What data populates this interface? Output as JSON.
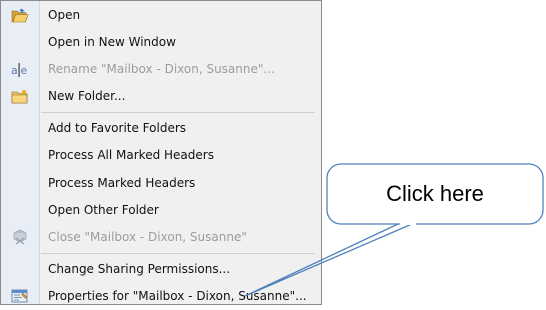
{
  "menu": {
    "items": [
      {
        "label": "Open",
        "enabled": true,
        "icon": "open-folder-icon"
      },
      {
        "label": "Open in New Window",
        "enabled": true,
        "icon": ""
      },
      {
        "label": "Rename \"Mailbox - Dixon, Susanne\"...",
        "enabled": false,
        "icon": "rename-icon"
      },
      {
        "label": "New Folder...",
        "enabled": true,
        "icon": "new-folder-icon"
      },
      {
        "label": "Add to Favorite Folders",
        "enabled": true,
        "icon": ""
      },
      {
        "label": "Process All Marked Headers",
        "enabled": true,
        "icon": ""
      },
      {
        "label": "Process Marked Headers",
        "enabled": true,
        "icon": ""
      },
      {
        "label": "Open Other Folder",
        "enabled": true,
        "icon": ""
      },
      {
        "label": "Close \"Mailbox - Dixon, Susanne\"",
        "enabled": false,
        "icon": "close-mailbox-icon"
      },
      {
        "label": "Change Sharing Permissions...",
        "enabled": true,
        "icon": ""
      },
      {
        "label": "Properties for \"Mailbox - Dixon, Susanne\"...",
        "enabled": true,
        "icon": "properties-icon"
      }
    ]
  },
  "callout": {
    "text": "Click here",
    "border_color": "#4f81bd",
    "fill_color": "#ffffff"
  },
  "colors": {
    "menu_bg": "#f0f0f0",
    "gutter_bg": "#e9eef6",
    "disabled_text": "#9c9c9c",
    "folder_yellow": "#e8b84a"
  }
}
